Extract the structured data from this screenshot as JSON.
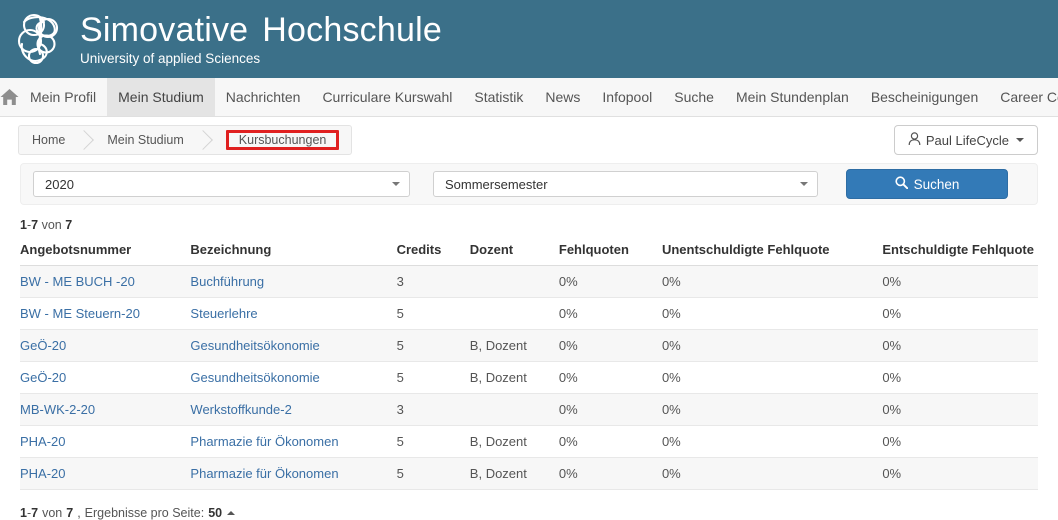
{
  "header": {
    "logo_icon": "celtic-knot-logo",
    "brand_name": "Simovative",
    "brand_name2": "Hochschule",
    "brand_subtitle": "University of applied Sciences",
    "bg_color": "#3b7089"
  },
  "nav": {
    "home_icon": "home-icon",
    "items": [
      {
        "label": "Mein Profil",
        "active": false
      },
      {
        "label": "Mein Studium",
        "active": true
      },
      {
        "label": "Nachrichten",
        "active": false
      },
      {
        "label": "Curriculare Kurswahl",
        "active": false
      },
      {
        "label": "Statistik",
        "active": false
      },
      {
        "label": "News",
        "active": false
      },
      {
        "label": "Infopool",
        "active": false
      },
      {
        "label": "Suche",
        "active": false
      },
      {
        "label": "Mein Stundenplan",
        "active": false
      },
      {
        "label": "Bescheinigungen",
        "active": false
      },
      {
        "label": "Career Center",
        "active": false
      }
    ]
  },
  "breadcrumb": {
    "items": [
      {
        "label": "Home",
        "highlighted": false
      },
      {
        "label": "Mein Studium",
        "highlighted": false
      },
      {
        "label": "Kursbuchungen",
        "highlighted": true
      }
    ],
    "highlight_color": "#e02020"
  },
  "user": {
    "icon": "user-icon",
    "name": "Paul LifeCycle",
    "caret_icon": "caret-down-icon"
  },
  "filter": {
    "year_value": "2020",
    "term_value": "Sommersemester",
    "search_label": "Suchen",
    "search_icon": "search-icon",
    "search_color": "#337ab7"
  },
  "results": {
    "count_prefix": "1",
    "count_dash": "-",
    "count_to": "7",
    "count_von": "von",
    "count_total": "7",
    "count_text": "1 - 7 von 7",
    "columns": [
      "Angebotsnummer",
      "Bezeichnung",
      "Credits",
      "Dozent",
      "Fehlquoten",
      "Unentschuldigte Fehlquote",
      "Entschuldigte Fehlquote"
    ],
    "rows": [
      {
        "angebotsnummer": "BW - ME BUCH -20",
        "bezeichnung": "Buchführung",
        "credits": "3",
        "dozent": "",
        "fehlquoten": "0%",
        "unentschuldigte": "0%",
        "entschuldigte": "0%"
      },
      {
        "angebotsnummer": "BW - ME Steuern-20",
        "bezeichnung": "Steuerlehre",
        "credits": "5",
        "dozent": "",
        "fehlquoten": "0%",
        "unentschuldigte": "0%",
        "entschuldigte": "0%"
      },
      {
        "angebotsnummer": "GeÖ-20",
        "bezeichnung": "Gesundheitsökonomie",
        "credits": "5",
        "dozent": "B, Dozent",
        "fehlquoten": "0%",
        "unentschuldigte": "0%",
        "entschuldigte": "0%"
      },
      {
        "angebotsnummer": "GeÖ-20",
        "bezeichnung": "Gesundheitsökonomie",
        "credits": "5",
        "dozent": "B, Dozent",
        "fehlquoten": "0%",
        "unentschuldigte": "0%",
        "entschuldigte": "0%"
      },
      {
        "angebotsnummer": "MB-WK-2-20",
        "bezeichnung": "Werkstoffkunde-2",
        "credits": "3",
        "dozent": "",
        "fehlquoten": "0%",
        "unentschuldigte": "0%",
        "entschuldigte": "0%"
      },
      {
        "angebotsnummer": "PHA-20",
        "bezeichnung": "Pharmazie für Ökonomen",
        "credits": "5",
        "dozent": "B, Dozent",
        "fehlquoten": "0%",
        "unentschuldigte": "0%",
        "entschuldigte": "0%"
      },
      {
        "angebotsnummer": "PHA-20",
        "bezeichnung": "Pharmazie für Ökonomen",
        "credits": "5",
        "dozent": "B, Dozent",
        "fehlquoten": "0%",
        "unentschuldigte": "0%",
        "entschuldigte": "0%"
      }
    ]
  },
  "footer": {
    "count_from": "1",
    "dash": "-",
    "count_to": "7",
    "von": "von",
    "count_total": "7",
    "comma": ",",
    "per_page_label": "Ergebnisse pro Seite:",
    "per_page_value": "50",
    "caret_icon": "caret-up-icon"
  }
}
